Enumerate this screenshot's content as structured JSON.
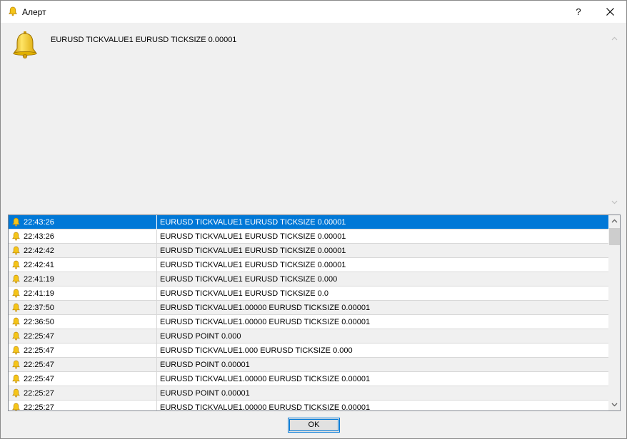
{
  "window": {
    "title": "Алерт",
    "help_label": "?",
    "ok_label": "OK"
  },
  "alert": {
    "message": "EURUSD TICKVALUE1 EURUSD TICKSIZE 0.00001"
  },
  "history": {
    "rows": [
      {
        "time": "22:43:26",
        "message": "EURUSD TICKVALUE1 EURUSD TICKSIZE 0.00001"
      },
      {
        "time": "22:43:26",
        "message": "EURUSD TICKVALUE1 EURUSD TICKSIZE 0.00001"
      },
      {
        "time": "22:42:42",
        "message": "EURUSD TICKVALUE1 EURUSD TICKSIZE 0.00001"
      },
      {
        "time": "22:42:41",
        "message": "EURUSD TICKVALUE1 EURUSD TICKSIZE 0.00001"
      },
      {
        "time": "22:41:19",
        "message": "EURUSD TICKVALUE1 EURUSD TICKSIZE 0.000"
      },
      {
        "time": "22:41:19",
        "message": "EURUSD TICKVALUE1 EURUSD TICKSIZE 0.0"
      },
      {
        "time": "22:37:50",
        "message": "EURUSD TICKVALUE1.00000 EURUSD TICKSIZE 0.00001"
      },
      {
        "time": "22:36:50",
        "message": "EURUSD TICKVALUE1.00000 EURUSD TICKSIZE 0.00001"
      },
      {
        "time": "22:25:47",
        "message": "EURUSD POINT 0.000"
      },
      {
        "time": "22:25:47",
        "message": "EURUSD TICKVALUE1.000 EURUSD TICKSIZE 0.000"
      },
      {
        "time": "22:25:47",
        "message": "EURUSD POINT 0.00001"
      },
      {
        "time": "22:25:47",
        "message": "EURUSD TICKVALUE1.00000 EURUSD TICKSIZE 0.00001"
      },
      {
        "time": "22:25:27",
        "message": "EURUSD POINT 0.00001"
      },
      {
        "time": "22:25:27",
        "message": "EURUSD TICKVALUE1.00000 EURUSD TICKSIZE 0.00001"
      }
    ],
    "selected_index": 0
  },
  "icons": {
    "title": "bell-icon",
    "alert": "bell-icon",
    "row": "bell-icon",
    "close": "close-icon"
  },
  "colors": {
    "selection": "#0078d7",
    "bell": "#f2c200"
  }
}
